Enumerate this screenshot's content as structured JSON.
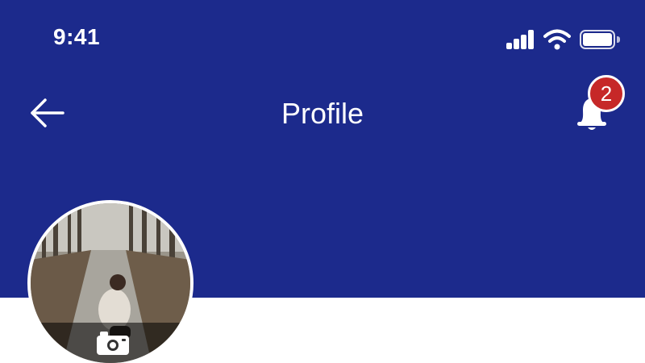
{
  "status_bar": {
    "time": "9:41",
    "icons": [
      "cellular-signal-icon",
      "wifi-icon",
      "battery-icon"
    ]
  },
  "nav": {
    "title": "Profile",
    "back_icon": "arrow-left-icon",
    "notification_icon": "bell-icon",
    "notification_count": "2"
  },
  "avatar": {
    "edit_icon": "camera-icon"
  },
  "colors": {
    "header_bg": "#1c2a8c",
    "badge_bg": "#c62828",
    "page_bg": "#ffffff"
  }
}
